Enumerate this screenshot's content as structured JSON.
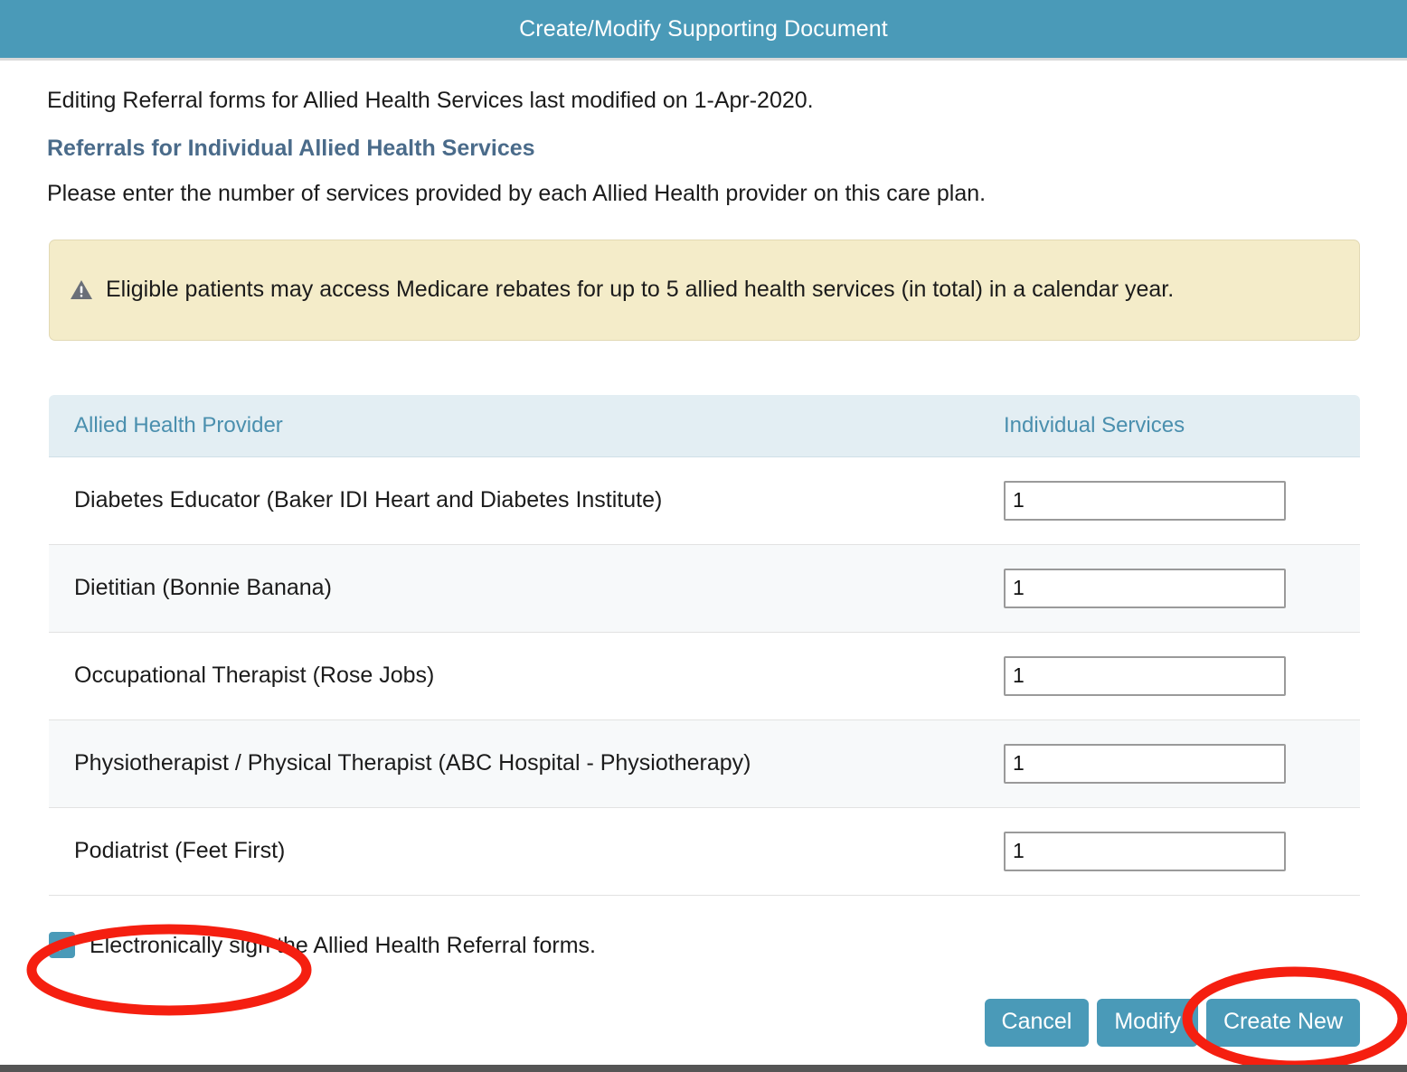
{
  "window": {
    "title": "Create/Modify Supporting Document",
    "title_bar_color": "#4a9ab8"
  },
  "body": {
    "intro": "Editing Referral forms for Allied Health Services last modified on 1-Apr-2020.",
    "section_heading": "Referrals for Individual Allied Health Services",
    "instruction": "Please enter the number of services provided by each Allied Health provider on this care plan."
  },
  "warning": {
    "icon": "warning-triangle-icon",
    "text": "Eligible patients may access Medicare rebates for up to 5 allied health services (in total) in a calendar year.",
    "background_color": "#f4ecc9"
  },
  "table": {
    "columns": [
      "Allied Health Provider",
      "Individual Services"
    ],
    "header_background": "#e3eef3",
    "header_text_color": "#4a8fae",
    "rows": [
      {
        "provider": "Diabetes Educator (Baker IDI Heart and Diabetes Institute)",
        "services": "1"
      },
      {
        "provider": "Dietitian (Bonnie Banana)",
        "services": "1"
      },
      {
        "provider": "Occupational Therapist (Rose Jobs)",
        "services": "1"
      },
      {
        "provider": "Physiotherapist / Physical Therapist (ABC Hospital - Physiotherapy)",
        "services": "1"
      },
      {
        "provider": "Podiatrist (Feet First)",
        "services": "1"
      }
    ]
  },
  "sign": {
    "checked": true,
    "checkbox_color": "#4a9ab8",
    "label": "Electronically sign the Allied Health Referral forms."
  },
  "buttons": {
    "cancel": "Cancel",
    "modify": "Modify",
    "create_new": "Create New",
    "color": "#4a9ab8"
  },
  "annotations": {
    "color": "#f51f10",
    "highlighted": [
      "electronically-sign-checkbox",
      "create-new-button"
    ]
  }
}
